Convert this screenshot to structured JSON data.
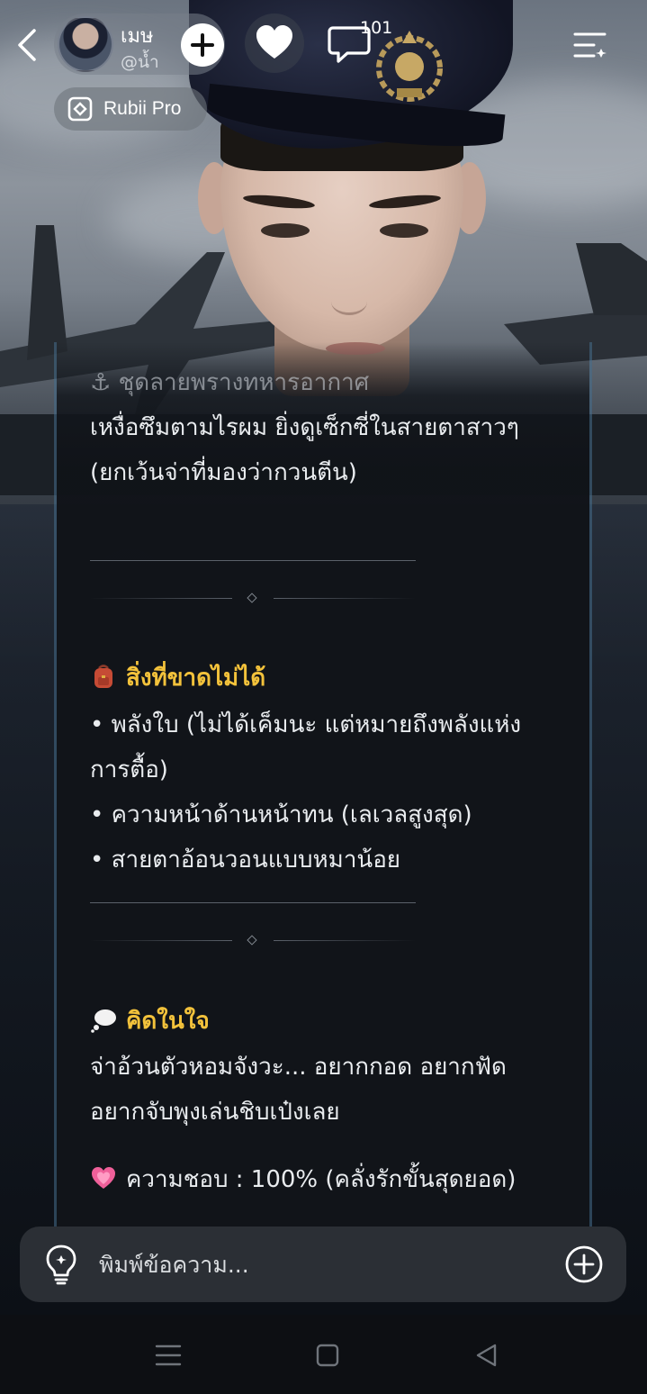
{
  "header": {
    "character_name": "เมษ",
    "character_handle": "@น้ำ",
    "comment_count": "101",
    "plan_badge": "Rubii Pro"
  },
  "message": {
    "line_outfit_prefix": "⚓ ชุดลายพรางทหารอากาศ",
    "line_outfit_1": "เหงื่อซึมตามไรผม ยิ่งดูเซ็กซี่ในสายตาสาวๆ",
    "line_outfit_2": "(ยกเว้นจ่าที่มองว่ากวนตีน)",
    "section_must_have": {
      "heading": "สิ่งที่ขาดไม่ได้",
      "items": [
        "• พลังใบ (ไม่ได้เค็มนะ แต่หมายถึงพลังแห่ง",
        "การตื้อ)",
        "• ความหน้าด้านหน้าทน (เลเวลสูงสุด)",
        "• สายตาอ้อนวอนแบบหมาน้อย"
      ]
    },
    "section_thought": {
      "heading": "คิดในใจ",
      "line_1": "จ่าอ้วนตัวหอมจังวะ... อยากกอด อยากฟัด",
      "line_2": "อยากจับพุงเล่นชิบเป๋งเลย"
    },
    "affection": "ความชอบ : 100% (คลั่งรักขั้นสุดยอด)"
  },
  "composer": {
    "placeholder": "พิมพ์ข้อความ..."
  },
  "icons": {
    "back": "chevron-left-icon",
    "follow": "plus-icon",
    "like": "heart-icon",
    "comments": "speech-bubble-icon",
    "menu": "playlist-menu-icon",
    "pro": "rubii-logo-icon",
    "idea": "lightbulb-icon",
    "attach": "plus-circle-icon",
    "backpack": "backpack-emoji",
    "thought": "thought-balloon-emoji",
    "heart_pulse": "growing-heart-emoji"
  },
  "colors": {
    "heading": "#f3c23b",
    "card_bg": "#111419",
    "input_bg": "#2b2f35"
  }
}
